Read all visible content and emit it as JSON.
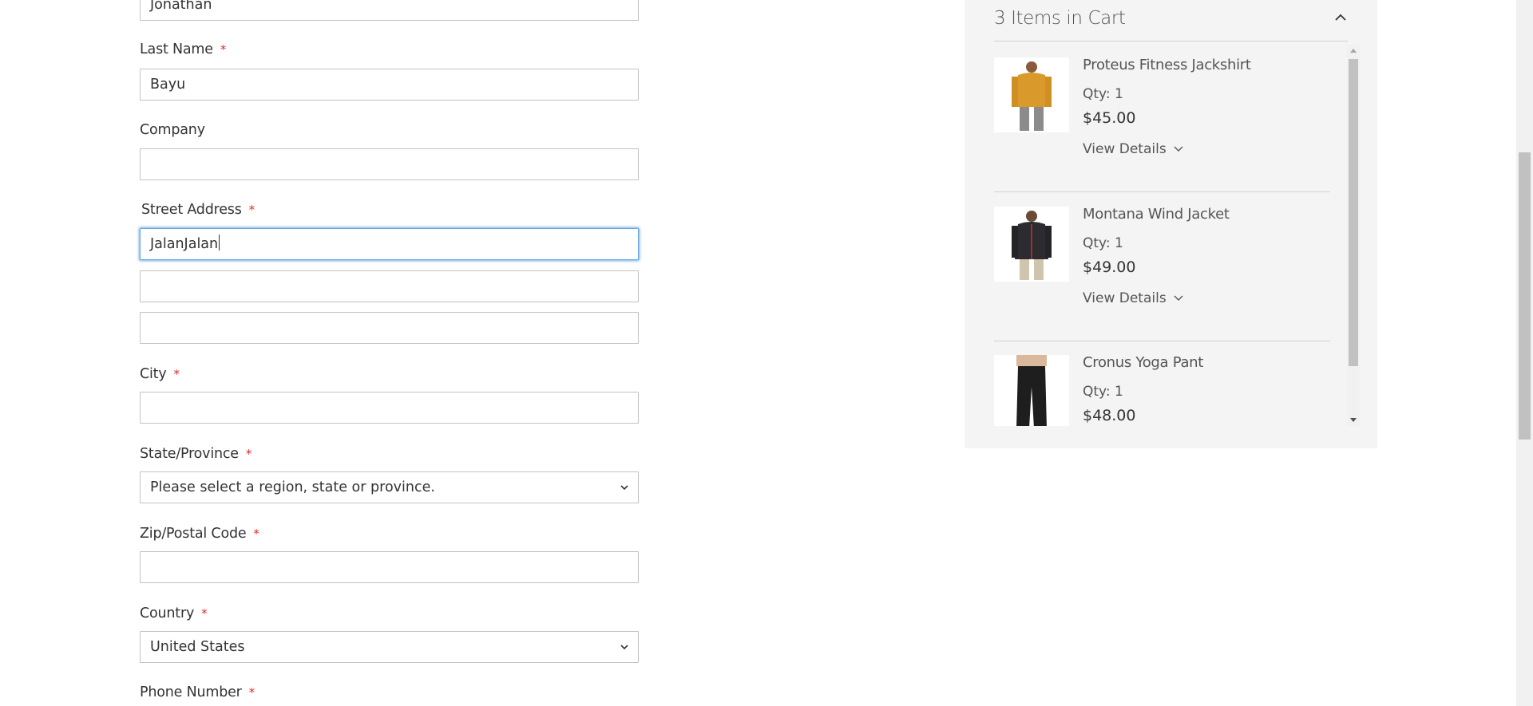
{
  "form": {
    "first_name": {
      "value": "Jonathan"
    },
    "last_name": {
      "label": "Last Name",
      "required": "*",
      "value": "Bayu"
    },
    "company": {
      "label": "Company",
      "value": ""
    },
    "street": {
      "label": "Street Address",
      "required": "*",
      "line1": "JalanJalan",
      "line2": "",
      "line3": ""
    },
    "city": {
      "label": "City",
      "required": "*",
      "value": ""
    },
    "state": {
      "label": "State/Province",
      "required": "*",
      "selected": "Please select a region, state or province."
    },
    "zip": {
      "label": "Zip/Postal Code",
      "required": "*",
      "value": ""
    },
    "country": {
      "label": "Country",
      "required": "*",
      "selected": "United States"
    },
    "phone": {
      "label": "Phone Number",
      "required": "*"
    }
  },
  "cart": {
    "title": "3 Items in Cart",
    "toggle_icon": "chevron-up-icon",
    "items": [
      {
        "name": "Proteus Fitness Jackshirt",
        "qty": "Qty: 1",
        "price": "$45.00",
        "details": "View Details",
        "thumb_color": "#d99a2b"
      },
      {
        "name": "Montana Wind Jacket",
        "qty": "Qty: 1",
        "price": "$49.00",
        "details": "View Details",
        "thumb_color": "#2b2b30"
      },
      {
        "name": "Cronus Yoga Pant",
        "qty": "Qty: 1",
        "price": "$48.00",
        "details": "",
        "thumb_color": "#1e1e1e"
      }
    ]
  },
  "colors": {
    "required": "#e02b27",
    "focus": "#68a8e0",
    "cart_bg": "#f4f4f4"
  }
}
